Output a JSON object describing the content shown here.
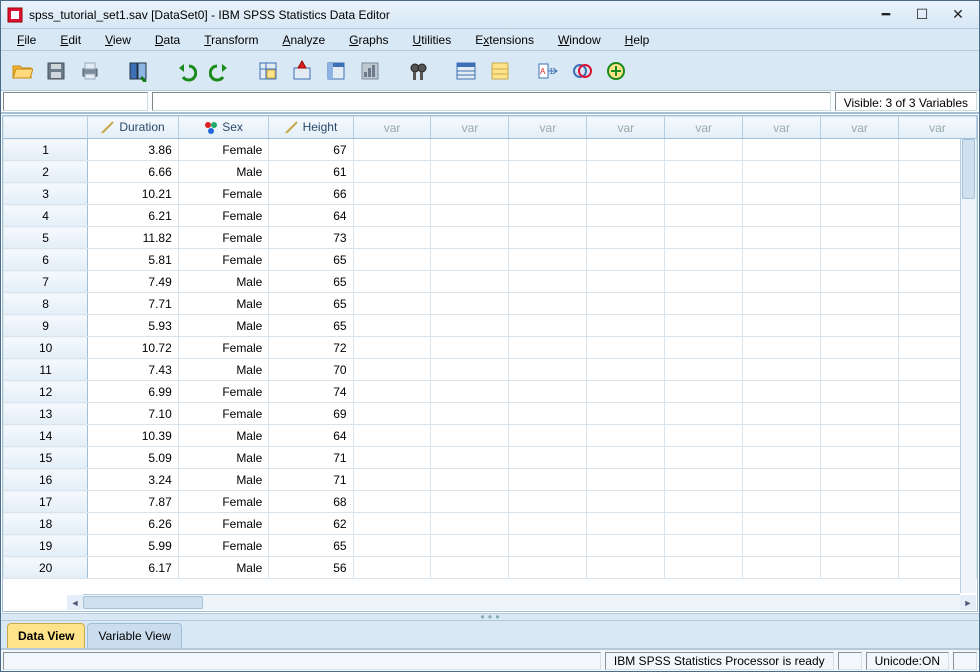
{
  "titlebar": {
    "title": "spss_tutorial_set1.sav [DataSet0] - IBM SPSS Statistics Data Editor"
  },
  "menu": {
    "items": [
      {
        "label": "File",
        "accel": "F"
      },
      {
        "label": "Edit",
        "accel": "E"
      },
      {
        "label": "View",
        "accel": "V"
      },
      {
        "label": "Data",
        "accel": "D"
      },
      {
        "label": "Transform",
        "accel": "T"
      },
      {
        "label": "Analyze",
        "accel": "A"
      },
      {
        "label": "Graphs",
        "accel": "G"
      },
      {
        "label": "Utilities",
        "accel": "U"
      },
      {
        "label": "Extensions",
        "accel": "x"
      },
      {
        "label": "Window",
        "accel": "W"
      },
      {
        "label": "Help",
        "accel": "H"
      }
    ]
  },
  "visible_text": "Visible: 3 of 3 Variables",
  "columns": [
    {
      "name": "Duration",
      "type": "scale"
    },
    {
      "name": "Sex",
      "type": "nominal"
    },
    {
      "name": "Height",
      "type": "scale"
    }
  ],
  "empty_col_label": "var",
  "empty_col_count": 8,
  "rows": [
    {
      "n": 1,
      "Duration": "3.86",
      "Sex": "Female",
      "Height": "67"
    },
    {
      "n": 2,
      "Duration": "6.66",
      "Sex": "Male",
      "Height": "61"
    },
    {
      "n": 3,
      "Duration": "10.21",
      "Sex": "Female",
      "Height": "66"
    },
    {
      "n": 4,
      "Duration": "6.21",
      "Sex": "Female",
      "Height": "64"
    },
    {
      "n": 5,
      "Duration": "11.82",
      "Sex": "Female",
      "Height": "73"
    },
    {
      "n": 6,
      "Duration": "5.81",
      "Sex": "Female",
      "Height": "65"
    },
    {
      "n": 7,
      "Duration": "7.49",
      "Sex": "Male",
      "Height": "65"
    },
    {
      "n": 8,
      "Duration": "7.71",
      "Sex": "Male",
      "Height": "65"
    },
    {
      "n": 9,
      "Duration": "5.93",
      "Sex": "Male",
      "Height": "65"
    },
    {
      "n": 10,
      "Duration": "10.72",
      "Sex": "Female",
      "Height": "72"
    },
    {
      "n": 11,
      "Duration": "7.43",
      "Sex": "Male",
      "Height": "70"
    },
    {
      "n": 12,
      "Duration": "6.99",
      "Sex": "Female",
      "Height": "74"
    },
    {
      "n": 13,
      "Duration": "7.10",
      "Sex": "Female",
      "Height": "69"
    },
    {
      "n": 14,
      "Duration": "10.39",
      "Sex": "Male",
      "Height": "64"
    },
    {
      "n": 15,
      "Duration": "5.09",
      "Sex": "Male",
      "Height": "71"
    },
    {
      "n": 16,
      "Duration": "3.24",
      "Sex": "Male",
      "Height": "71"
    },
    {
      "n": 17,
      "Duration": "7.87",
      "Sex": "Female",
      "Height": "68"
    },
    {
      "n": 18,
      "Duration": "6.26",
      "Sex": "Female",
      "Height": "62"
    },
    {
      "n": 19,
      "Duration": "5.99",
      "Sex": "Female",
      "Height": "65"
    },
    {
      "n": 20,
      "Duration": "6.17",
      "Sex": "Male",
      "Height": "56"
    }
  ],
  "viewtabs": {
    "data": "Data View",
    "variable": "Variable View"
  },
  "status": {
    "processor": "IBM SPSS Statistics Processor is ready",
    "unicode": "Unicode:ON"
  }
}
